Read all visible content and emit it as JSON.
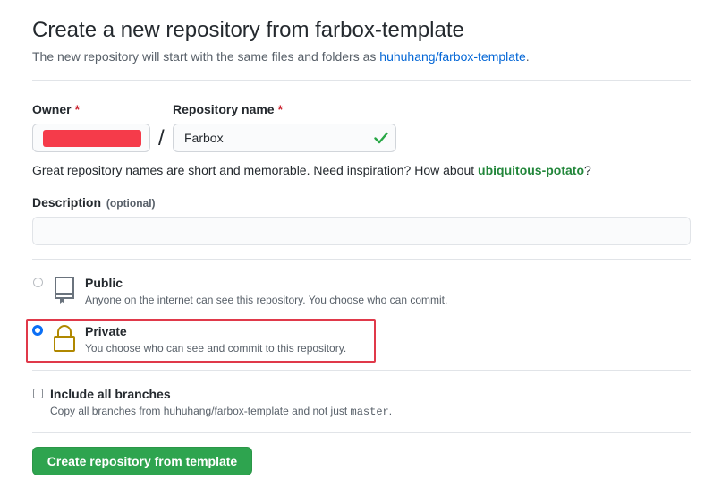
{
  "header": {
    "title": "Create a new repository from farbox-template",
    "subtitle_prefix": "The new repository will start with the same files and folders as ",
    "template_link": "huhuhang/farbox-template",
    "subtitle_suffix": "."
  },
  "owner": {
    "label": "Owner",
    "required_mark": "*"
  },
  "separator": "/",
  "repo_name": {
    "label": "Repository name",
    "required_mark": "*",
    "value": "Farbox"
  },
  "hint": {
    "prefix": "Great repository names are short and memorable. Need inspiration? How about ",
    "suggestion": "ubiquitous-potato",
    "suffix": "?"
  },
  "description": {
    "label": "Description",
    "optional": "(optional)",
    "value": ""
  },
  "visibility": {
    "selected": "private",
    "public": {
      "title": "Public",
      "desc": "Anyone on the internet can see this repository. You choose who can commit."
    },
    "private": {
      "title": "Private",
      "desc": "You choose who can see and commit to this repository."
    }
  },
  "branches": {
    "checked": false,
    "label": "Include all branches",
    "desc_prefix": "Copy all branches from huhuhang/farbox-template and not just ",
    "desc_code": "master",
    "desc_suffix": "."
  },
  "submit_label": "Create repository from template",
  "colors": {
    "primary_button": "#2ea44f",
    "link": "#0366d6",
    "suggestion": "#22863a",
    "required": "#cb2431",
    "check": "#28a745",
    "lock": "#b08800",
    "highlight": "#e0394a",
    "redaction": "#f53b4a"
  }
}
